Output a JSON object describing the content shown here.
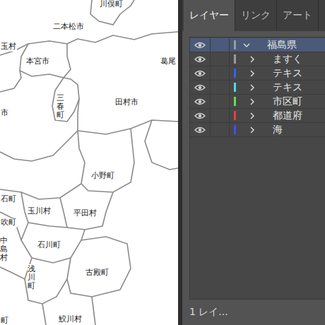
{
  "map": {
    "labels": [
      {
        "text": "川俣町",
        "vertical": false
      },
      {
        "text": "二本松市",
        "vertical": false
      },
      {
        "text": "玉村",
        "vertical": false
      },
      {
        "text": "本宮市",
        "vertical": false
      },
      {
        "text": "葛尾",
        "vertical": false
      },
      {
        "text": "三春町",
        "vertical": true
      },
      {
        "text": "田村市",
        "vertical": false
      },
      {
        "text": "市",
        "vertical": false
      },
      {
        "text": "小野町",
        "vertical": false
      },
      {
        "text": "石町",
        "vertical": false
      },
      {
        "text": "玉川村",
        "vertical": false
      },
      {
        "text": "平田村",
        "vertical": false
      },
      {
        "text": "吹町",
        "vertical": false
      },
      {
        "text": "中島村",
        "vertical": true
      },
      {
        "text": "石川町",
        "vertical": false
      },
      {
        "text": "浅川町",
        "vertical": true
      },
      {
        "text": "古殿町",
        "vertical": false
      },
      {
        "text": "鮫川村",
        "vertical": false
      },
      {
        "text": "町",
        "vertical": false
      }
    ]
  },
  "panel": {
    "tabs": [
      {
        "label": "レイヤー",
        "selected": true
      },
      {
        "label": "リンク",
        "selected": false
      },
      {
        "label": "アート",
        "selected": false
      }
    ],
    "layers": [
      {
        "name": "福島県",
        "selected": true,
        "expanded": true,
        "visible": true,
        "color": "#9a9a9a"
      },
      {
        "name": "ますく",
        "selected": false,
        "expanded": false,
        "visible": true,
        "color": "#9a9a9a"
      },
      {
        "name": "テキス",
        "selected": false,
        "expanded": false,
        "visible": true,
        "color": "#3b5cff"
      },
      {
        "name": "テキス",
        "selected": false,
        "expanded": false,
        "visible": true,
        "color": "#4fd8ea"
      },
      {
        "name": "市区町",
        "selected": false,
        "expanded": false,
        "visible": true,
        "color": "#63de4e"
      },
      {
        "name": "都道府",
        "selected": false,
        "expanded": false,
        "visible": true,
        "color": "#e23f3f"
      },
      {
        "name": "海",
        "selected": false,
        "expanded": false,
        "visible": true,
        "color": "#3f4ff2"
      }
    ],
    "footer": "1 レイ..."
  }
}
